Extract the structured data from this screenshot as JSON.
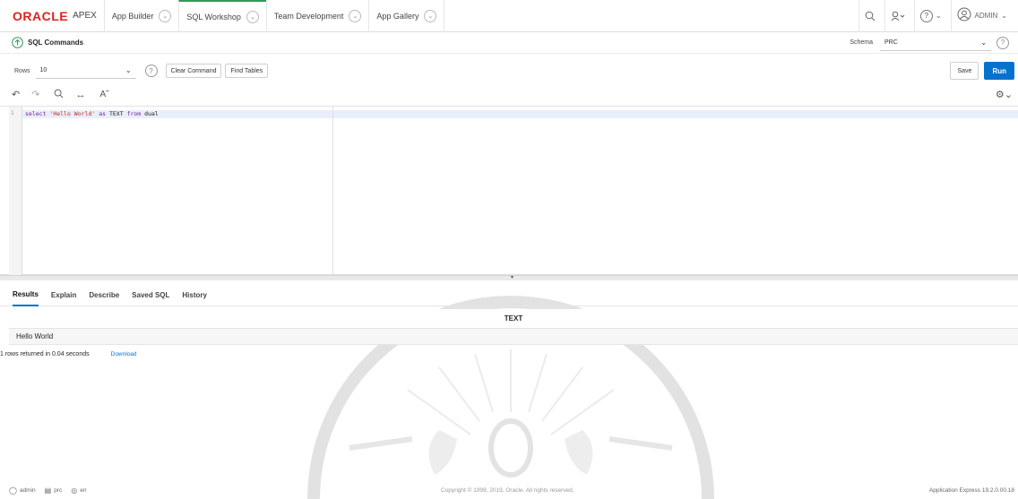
{
  "brand": {
    "oracle": "ORACLE",
    "apex": "APEX"
  },
  "nav": {
    "tabs": [
      {
        "label": "App Builder"
      },
      {
        "label": "SQL Workshop"
      },
      {
        "label": "Team Development"
      },
      {
        "label": "App Gallery"
      }
    ],
    "user": "ADMIN"
  },
  "page": {
    "title": "SQL Commands"
  },
  "schema": {
    "label": "Schema",
    "value": "PRC"
  },
  "controls": {
    "rows_label": "Rows",
    "rows_value": "10",
    "clear_label": "Clear Command",
    "find_label": "Find Tables",
    "save_label": "Save",
    "run_label": "Run"
  },
  "editor": {
    "line_number": "1",
    "keyword1": "select",
    "string": "'Hello World'",
    "keyword2": "as",
    "ident": "TEXT",
    "keyword3": "from",
    "table": "dual"
  },
  "results": {
    "tabs": [
      {
        "label": "Results"
      },
      {
        "label": "Explain"
      },
      {
        "label": "Describe"
      },
      {
        "label": "Saved SQL"
      },
      {
        "label": "History"
      }
    ],
    "column": "TEXT",
    "value": "Hello World",
    "status": "1 rows returned in 0.04 seconds",
    "download": "Download"
  },
  "footer": {
    "user": "admin",
    "schema": "prc",
    "lang": "en",
    "copyright": "Copyright © 1999, 2019, Oracle. All rights reserved.",
    "version": "Application Express 19.2.0.00.18"
  },
  "colors": {
    "accent": "#0572ce",
    "brand_red": "#e02020",
    "active_tab": "#2d9c5a"
  }
}
